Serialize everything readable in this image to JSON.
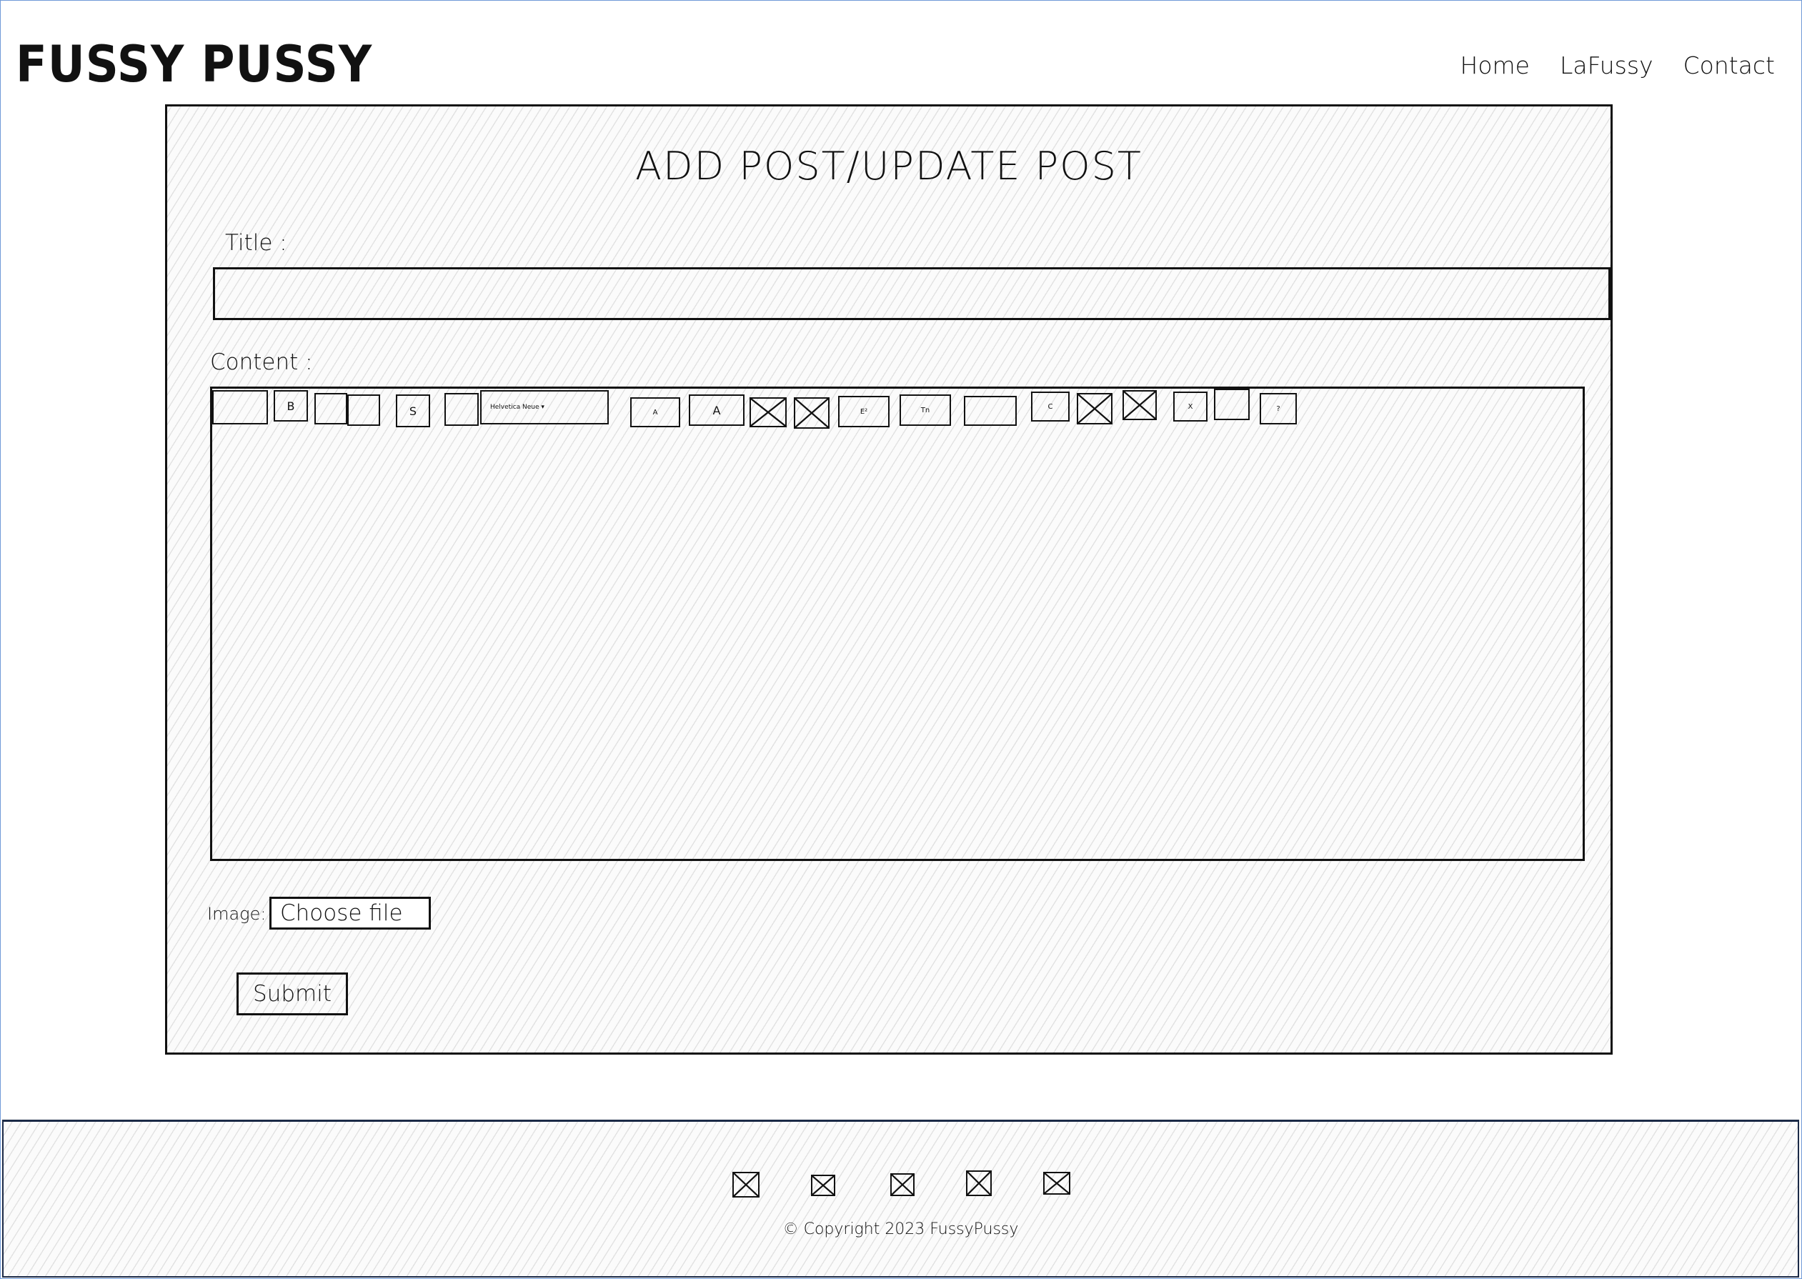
{
  "brand": "FUSSY PUSSY",
  "nav": {
    "home": "Home",
    "lafussy": "LaFussy",
    "contact": "Contact"
  },
  "form": {
    "heading": "ADD POST/UPDATE POST",
    "title_label": "Title :",
    "title_value": "",
    "content_label": "Content :",
    "image_label": "Image:",
    "file_button": "Choose file",
    "submit": "Submit"
  },
  "toolbar": {
    "bold": "B",
    "strike": "S",
    "font_dropdown": "Helvetica Neue ▾",
    "font_size_small": "A",
    "font_size_large": "A",
    "superscript": "E²",
    "subscript": "Tn",
    "code": "C",
    "clear": "X",
    "help": "?"
  },
  "footer": {
    "social_icons": [
      "social-icon-1",
      "social-icon-2",
      "social-icon-3",
      "social-icon-4",
      "social-icon-5"
    ],
    "copyright": "© Copyright 2023 FussyPussy"
  },
  "colors": {
    "frame_border": "#6f9ad8",
    "footer_border": "#1b2a47",
    "ink": "#111111"
  }
}
